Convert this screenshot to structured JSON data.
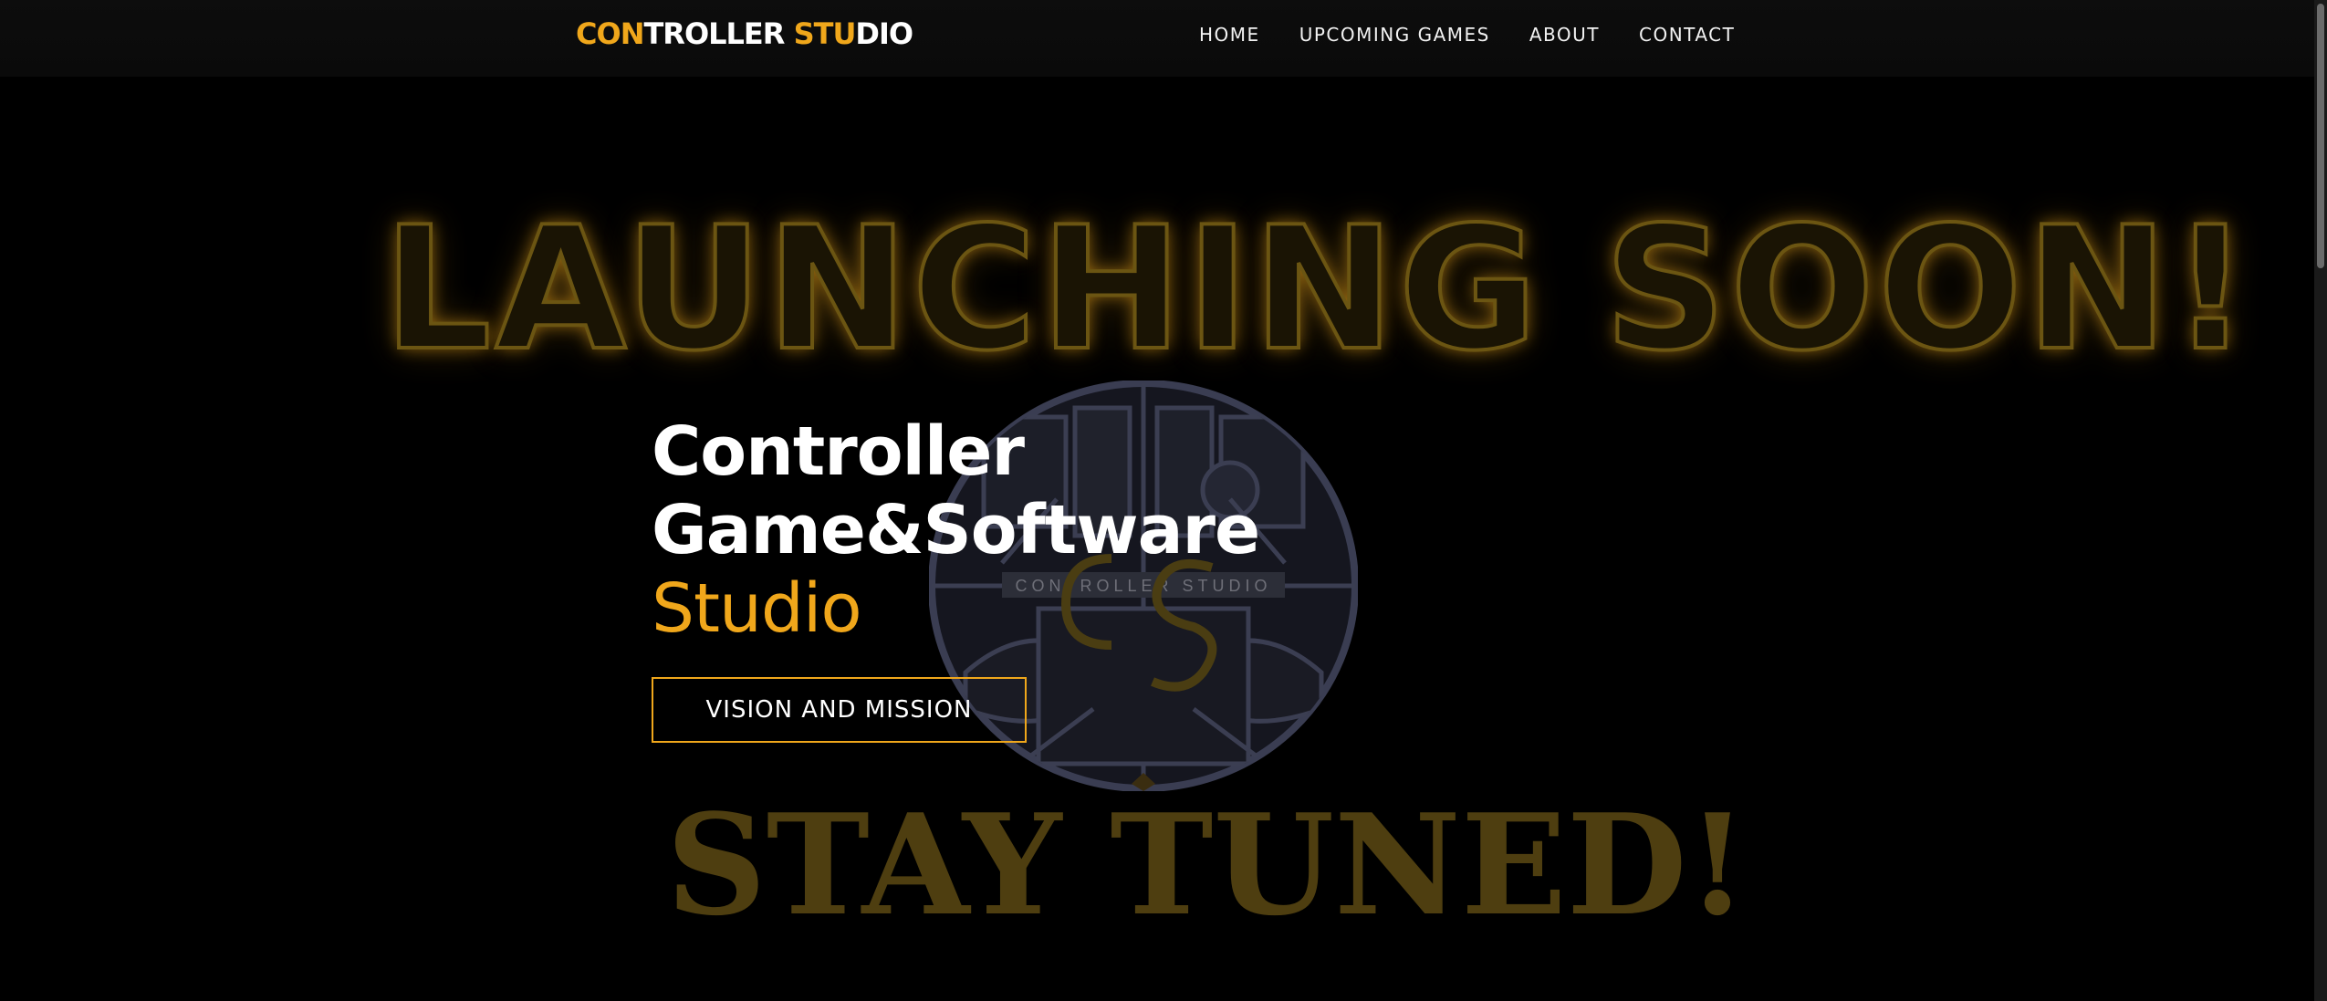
{
  "header": {
    "logo_part1": "CON",
    "logo_part2": "TROLLER ",
    "logo_part3": "STU",
    "logo_part4": "DIO",
    "nav": [
      "HOME",
      "UPCOMING GAMES",
      "ABOUT",
      "CONTACT"
    ]
  },
  "hero": {
    "banner": "LAUNCHING SOON!",
    "line1": "Controller",
    "line2": "Game&Software",
    "line3": "Studio",
    "cta_label": "VISION AND MISSION",
    "emblem_text": "CONTROLLER STUDIO",
    "footer_banner": "STAY TUNED!"
  },
  "colors": {
    "accent": "#f0a71b",
    "background": "#000000",
    "text": "#ffffff"
  }
}
